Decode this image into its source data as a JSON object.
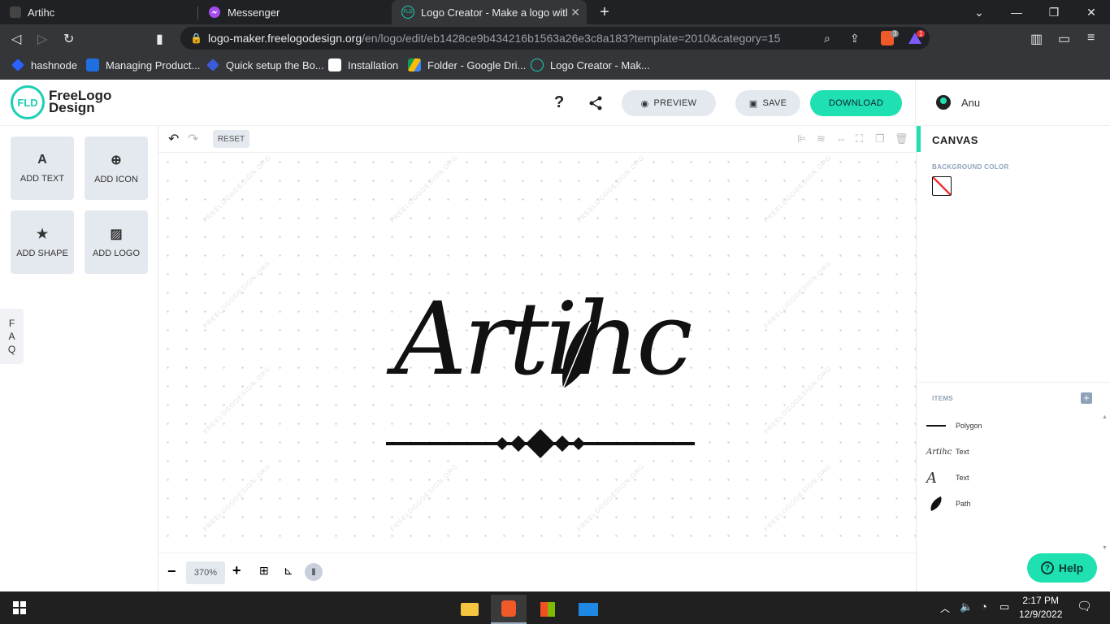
{
  "browser": {
    "tabs": [
      {
        "title": "Artihc"
      },
      {
        "title": "Messenger"
      },
      {
        "title": "Logo Creator - Make a logo with F"
      }
    ],
    "url_host": "logo-maker.freelogodesign.org",
    "url_path": "/en/logo/edit/eb1428ce9b434216b1563a26e3c8a183?template=2010&category=15",
    "brave_shield_count": "3",
    "rewards_count": "1",
    "bookmarks": [
      {
        "label": "hashnode"
      },
      {
        "label": "Managing Product..."
      },
      {
        "label": "Quick setup the Bo..."
      },
      {
        "label": "Installation"
      },
      {
        "label": "Folder - Google Dri..."
      },
      {
        "label": "Logo Creator - Mak..."
      }
    ]
  },
  "app": {
    "logo_mark": "FLD",
    "logo_line1": "FreeLogo",
    "logo_line2": "Design",
    "help_q": "?",
    "preview_label": "PREVIEW",
    "save_label": "SAVE",
    "download_label": "DOWNLOAD",
    "user_name": "Anu"
  },
  "tools": [
    {
      "label": "ADD TEXT",
      "icon": "A"
    },
    {
      "label": "ADD ICON",
      "icon": "globe-icon"
    },
    {
      "label": "ADD SHAPE",
      "icon": "star-icon"
    },
    {
      "label": "ADD LOGO",
      "icon": "image-icon"
    }
  ],
  "faq": {
    "l1": "F",
    "l2": "A",
    "l3": "Q"
  },
  "canvas": {
    "reset_label": "RESET",
    "logo_text": "Artihc",
    "watermark": "FREELOGODESIGN.ORG",
    "zoom": "370%"
  },
  "right_panel": {
    "title": "CANVAS",
    "bg_label": "BACKGROUND COLOR",
    "items_label": "ITEMS",
    "items": [
      {
        "label": "Polygon"
      },
      {
        "label": "Text"
      },
      {
        "label": "Text"
      },
      {
        "label": "Path"
      }
    ]
  },
  "help_label": "Help",
  "taskbar": {
    "time": "2:17 PM",
    "date": "12/9/2022"
  },
  "colors": {
    "accent": "#1ee0b0",
    "grey_button": "#e4e8ef",
    "chrome_dark": "#202124",
    "chrome_mid": "#35363a"
  }
}
